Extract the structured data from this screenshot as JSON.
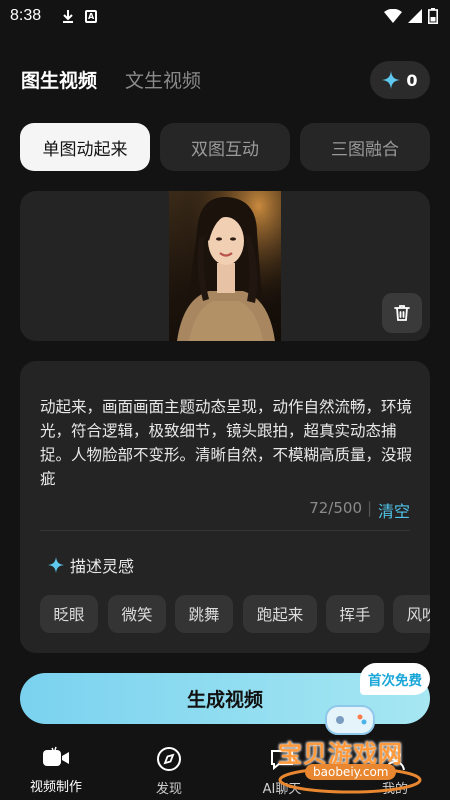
{
  "status_bar": {
    "time": "8:38"
  },
  "header": {
    "tabs": [
      {
        "label": "图生视频",
        "active": true
      },
      {
        "label": "文生视频",
        "active": false
      }
    ],
    "credits": "0"
  },
  "modes": [
    {
      "label": "单图动起来",
      "active": true
    },
    {
      "label": "双图互动",
      "active": false
    },
    {
      "label": "三图融合",
      "active": false
    }
  ],
  "prompt": {
    "text": "动起来，画面画面主题动态呈现，动作自然流畅，环境光，符合逻辑，极致细节，镜头跟拍，超真实动态捕捉。人物脸部不变形。清晰自然，不模糊高质量，没瑕疵",
    "counter": "72/500",
    "separator": "|",
    "clear_label": "清空",
    "inspire_label": "描述灵感",
    "chips": [
      "眨眼",
      "微笑",
      "跳舞",
      "跑起来",
      "挥手",
      "风吹"
    ]
  },
  "generate": {
    "label": "生成视频",
    "badge": "首次免费"
  },
  "nav": [
    {
      "label": "视频制作",
      "icon": "video-camera-icon",
      "active": true
    },
    {
      "label": "发现",
      "icon": "compass-icon",
      "active": false
    },
    {
      "label": "AI聊天",
      "icon": "chat-icon",
      "active": false
    },
    {
      "label": "我的",
      "icon": "profile-icon",
      "active": false
    }
  ],
  "watermark": {
    "text": "宝贝游戏网",
    "url": "baobeiy.com"
  },
  "colors": {
    "accent": "#4fc3e8",
    "background": "#131313",
    "panel": "#242424"
  }
}
